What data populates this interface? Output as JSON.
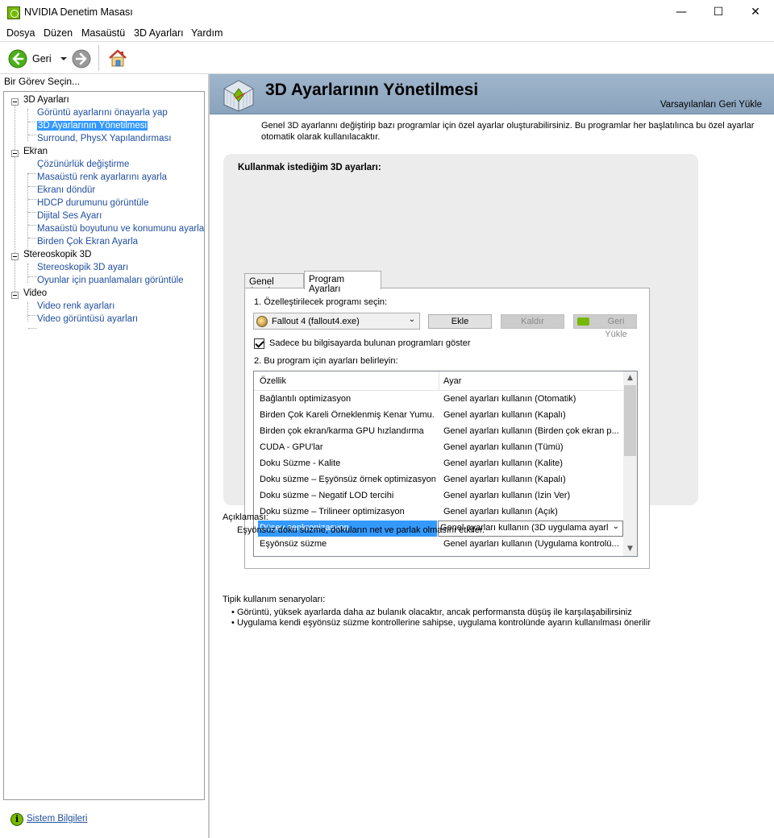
{
  "window": {
    "title": "NVIDIA Denetim Masası",
    "controls": {
      "minimize": "—",
      "maximize": "☐",
      "close": "✕"
    }
  },
  "menu": [
    "Dosya",
    "Düzen",
    "Masaüstü",
    "3D Ayarları",
    "Yardım"
  ],
  "toolbar": {
    "back_label": "Geri",
    "icons": [
      "back-arrow-icon",
      "dropdown-arrow-icon",
      "forward-arrow-icon",
      "home-icon"
    ]
  },
  "sidebar": {
    "header": "Bir Görev Seçin...",
    "groups": [
      {
        "label": "3D Ayarları",
        "items": [
          "Görüntü ayarlarını önayarla yap",
          "3D Ayarlarının Yönetilmesi",
          "Surround, PhysX Yapılandırması"
        ]
      },
      {
        "label": "Ekran",
        "items": [
          "Çözünürlük değiştirme",
          "Masaüstü renk ayarlarını ayarla",
          "Ekranı döndür",
          "HDCP durumunu görüntüle",
          "Dijital Ses Ayarı",
          "Masaüstü boyutunu ve konumunu ayarla",
          "Birden Çok Ekran Ayarla"
        ]
      },
      {
        "label": "Stereoskopik 3D",
        "items": [
          "Stereoskopik 3D ayarı",
          "Oyunlar için puanlamaları görüntüle"
        ]
      },
      {
        "label": "Video",
        "items": [
          "Video renk ayarları",
          "Video görüntüsü ayarları"
        ]
      }
    ],
    "selected": "3D Ayarlarının Yönetilmesi",
    "footer_link": "Sistem Bilgileri"
  },
  "main": {
    "title": "3D Ayarlarının Yönetilmesi",
    "restore_defaults": "Varsayılanları Geri Yükle",
    "intro": "Genel 3D ayarlannı değiştirip bazı programlar için özel ayarlar oluşturabilirsiniz. Bu programlar her başlatılınca bu özel ayarlar otomatik olarak kullanılacaktır.",
    "panel_heading": "Kullanmak istediğim 3D ayarları:",
    "tabs": [
      {
        "label": "Genel Ayarlar",
        "active": false
      },
      {
        "label": "Program Ayarları",
        "active": true
      }
    ],
    "step1_label": "1. Özelleştirilecek programı seçin:",
    "program_select_value": "Fallout 4 (fallout4.exe)",
    "buttons": {
      "add": "Ekle",
      "remove": "Kaldır",
      "restore": "Geri Yükle"
    },
    "checkbox_label": "Sadece bu bilgisayarda bulunan programları göster",
    "checkbox_checked": true,
    "step2_label": "2. Bu program için ayarları belirleyin:",
    "table": {
      "headers": [
        "Özellik",
        "Ayar"
      ],
      "rows": [
        [
          "Bağlantılı optimizasyon",
          "Genel ayarları kullanın (Otomatik)"
        ],
        [
          "Birden Çok Kareli Örneklenmiş Kenar Yumu...",
          "Genel ayarları kullanın (Kapalı)"
        ],
        [
          "Birden çok ekran/karma GPU hızlandırma",
          "Genel ayarları kullanın (Birden çok ekran p..."
        ],
        [
          "CUDA - GPU'lar",
          "Genel ayarları kullanın (Tümü)"
        ],
        [
          "Doku Süzme - Kalite",
          "Genel ayarları kullanın (Kalite)"
        ],
        [
          "Doku süzme – Eşyönsüz örnek optimizasyonu",
          "Genel ayarları kullanın (Kapalı)"
        ],
        [
          "Doku süzme – Negatif LOD tercihi",
          "Genel ayarları kullanın (İzin Ver)"
        ],
        [
          "Doku süzme – Trilineer optimizasyon",
          "Genel ayarları kullanın (Açık)"
        ],
        [
          "Düşey senkronizasyon",
          "Genel ayarları kullanın (3D uygulama ayarla"
        ],
        [
          "Eşyönsüz süzme",
          "Genel ayarları kullanın (Uygulama kontrolü..."
        ]
      ],
      "selected_row": 8
    },
    "description_label": "Açıklaması:",
    "description": "Eşyönsüz doku süzme, dokuların net ve parlak olmasını etkiler.",
    "usage_label": "Tipik kullanım senaryoları:",
    "usage_items": [
      "Görüntü, yüksek ayarlarda daha az bulanık olacaktır, ancak performansta düşüş ile karşılaşabilirsiniz",
      "Uygulama kendi eşyönsüz süzme kontrollerine sahipse, uygulama kontrolünde ayarın kullanılması önerilir"
    ]
  },
  "colors": {
    "accent": "#3399ff",
    "link": "#1f4e9e",
    "banner": "#9fb5cb",
    "nvidia_green": "#76b900"
  }
}
